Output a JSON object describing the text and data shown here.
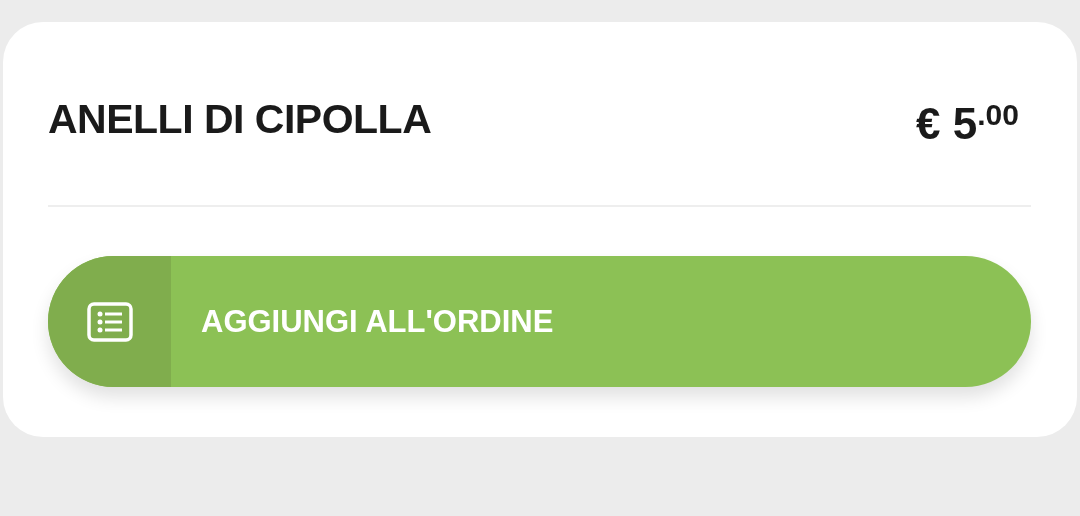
{
  "item": {
    "name": "ANELLI DI CIPOLLA",
    "price": "€ 5$^{.00}$"
  },
  "button": {
    "label": "AGGIUNGI ALL'ORDINE"
  }
}
